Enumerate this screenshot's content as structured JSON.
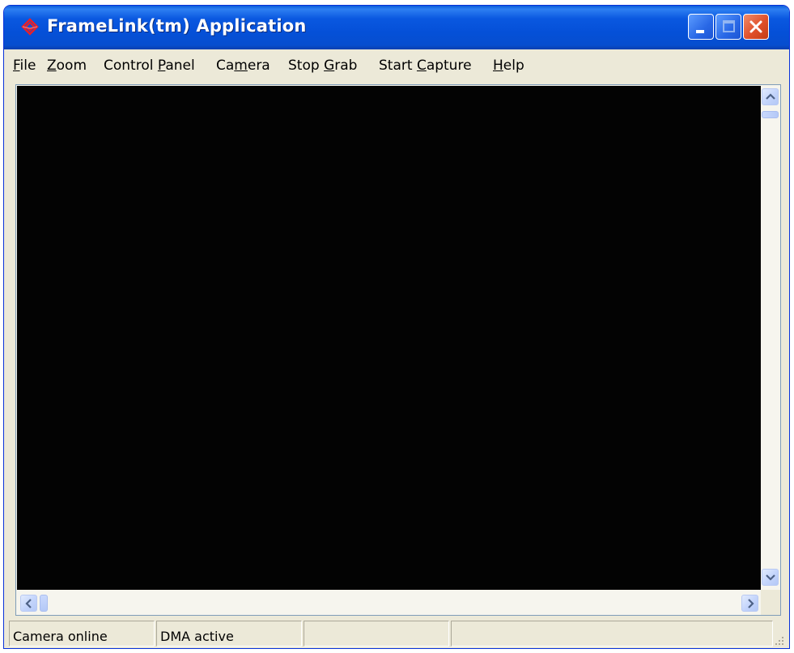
{
  "window": {
    "title": "FrameLink(tm) Application",
    "icon": "framelink-logo-icon",
    "controls": [
      "minimize-icon",
      "maximize-icon",
      "close-icon"
    ]
  },
  "menu": [
    {
      "pre": "",
      "key": "F",
      "post": "ile"
    },
    {
      "pre": "",
      "key": "Z",
      "post": "oom"
    },
    {
      "pre": "Control ",
      "key": "P",
      "post": "anel"
    },
    {
      "pre": "Ca",
      "key": "m",
      "post": "era"
    },
    {
      "pre": "Stop ",
      "key": "G",
      "post": "rab"
    },
    {
      "pre": "Start ",
      "key": "C",
      "post": "apture"
    },
    {
      "pre": "",
      "key": "H",
      "post": "elp"
    }
  ],
  "statusbar": {
    "panes": [
      "Camera online",
      "DMA active",
      "",
      ""
    ]
  },
  "colors": {
    "titlebar": "#0550d8",
    "viewport": "#030303",
    "close_button": "#e0502a"
  }
}
